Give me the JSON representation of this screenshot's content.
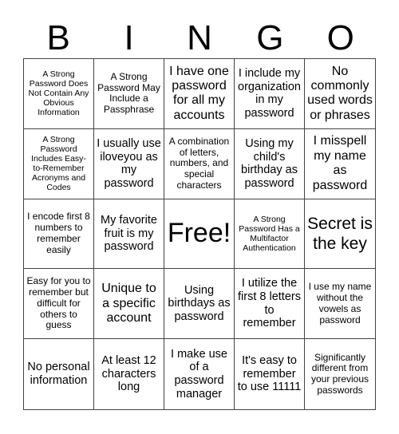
{
  "header": {
    "letters": [
      "B",
      "I",
      "N",
      "G",
      "O"
    ]
  },
  "cells": [
    "A Strong Password Does Not Contain Any Obvious Information",
    "A Strong Password May Include a Passphrase",
    "I have one password for all my accounts",
    "I include my organization in my password",
    "No commonly used words or phrases",
    "A Strong Password Includes Easy-to-Remember Acronyms and Codes",
    "I usually use iloveyou as my password",
    "A combination of letters, numbers, and special characters",
    "Using my child's birthday as password",
    "I misspell my name as password",
    "I encode first 8 numbers to remember easily",
    "My favorite fruit is my password",
    "Free!",
    "A Strong Password Has a Multifactor Authentication",
    "Secret is the key",
    "Easy for you to remember but difficult for others to guess",
    "Unique to a specific account",
    "Using birthdays as password",
    "I utilize the first 8 letters to remember",
    "I use my name without the vowels as password",
    "No personal information",
    "At least 12 characters long",
    "I make use of a password manager",
    "It's easy to remember to use 11111",
    "Significantly different from your previous passwords"
  ]
}
